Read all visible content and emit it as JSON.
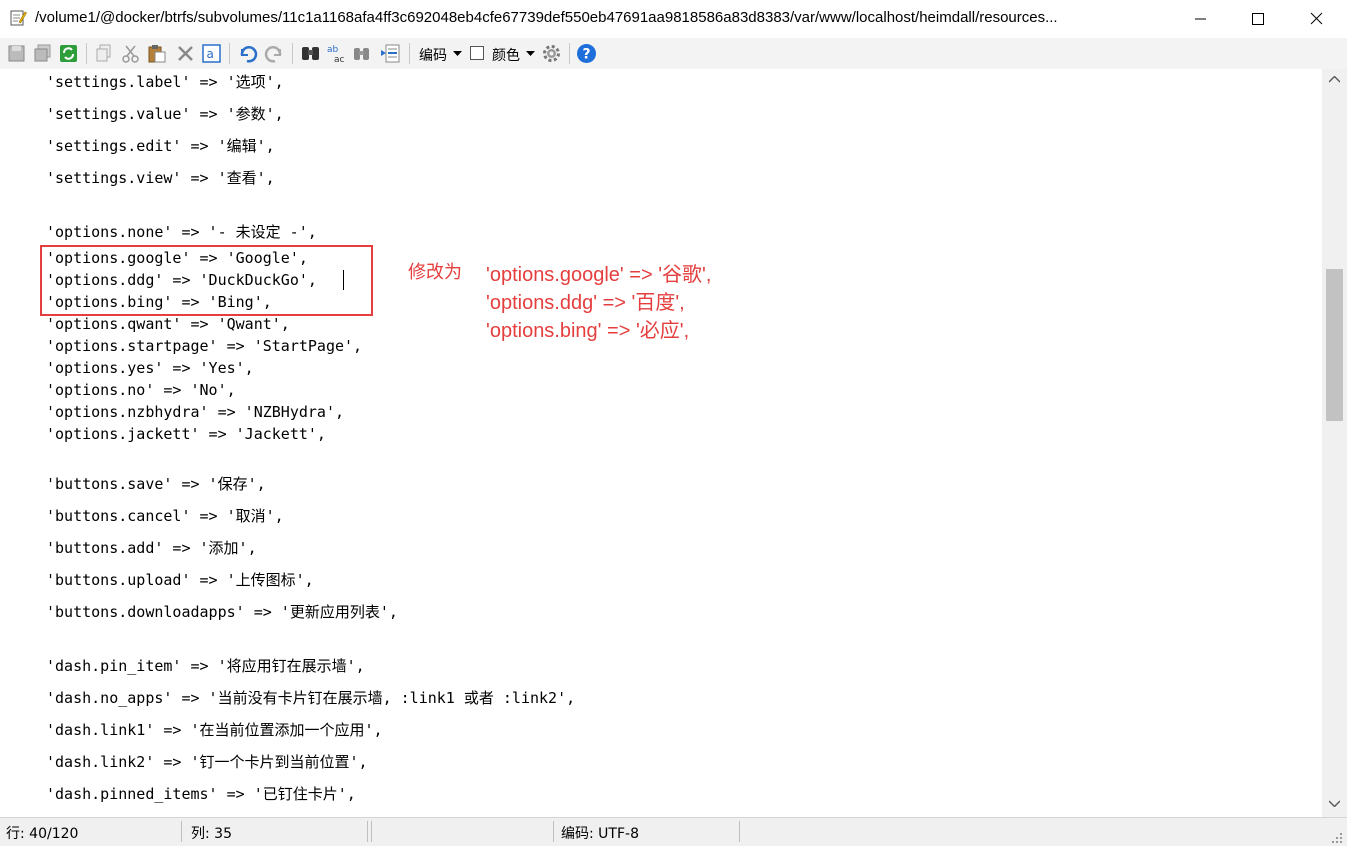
{
  "window": {
    "title": "/volume1/@docker/btrfs/subvolumes/11c1a1168afa4ff3c692048eb4cfe67739def550eb47691aa9818586a83d8383/var/www/localhost/heimdall/resources..."
  },
  "toolbar": {
    "encoding_label": "编码",
    "color_label": "颜色"
  },
  "editor": {
    "lines": [
      "'settings.label' => '选项',",
      "'settings.value' => '参数',",
      "'settings.edit' => '编辑',",
      "'settings.view' => '查看',",
      "'options.none' => '- 未设定 -',",
      "'options.google' => 'Google',",
      "'options.ddg' => 'DuckDuckGo',",
      "'options.bing' => 'Bing',",
      "'options.qwant' => 'Qwant',",
      "'options.startpage' => 'StartPage',",
      "'options.yes' => 'Yes',",
      "'options.no' => 'No',",
      "'options.nzbhydra' => 'NZBHydra',",
      "'options.jackett' => 'Jackett',",
      "'buttons.save' => '保存',",
      "'buttons.cancel' => '取消',",
      "'buttons.add' => '添加',",
      "'buttons.upload' => '上传图标',",
      "'buttons.downloadapps' => '更新应用列表',",
      "'dash.pin_item' => '将应用钉在展示墙',",
      "'dash.no_apps' => '当前没有卡片钉在展示墙, :link1 或者 :link2',",
      "'dash.link1' => '在当前位置添加一个应用',",
      "'dash.link2' => '钉一个卡片到当前位置',",
      "'dash.pinned_items' => '已钉住卡片',"
    ]
  },
  "annotation": {
    "label": "修改为",
    "lines": [
      "'options.google' => '谷歌',",
      "'options.ddg' => '百度',",
      "'options.bing' => '必应',"
    ]
  },
  "statusbar": {
    "line": "行: 40/120",
    "column": "列: 35",
    "encoding": "编码: UTF-8"
  }
}
